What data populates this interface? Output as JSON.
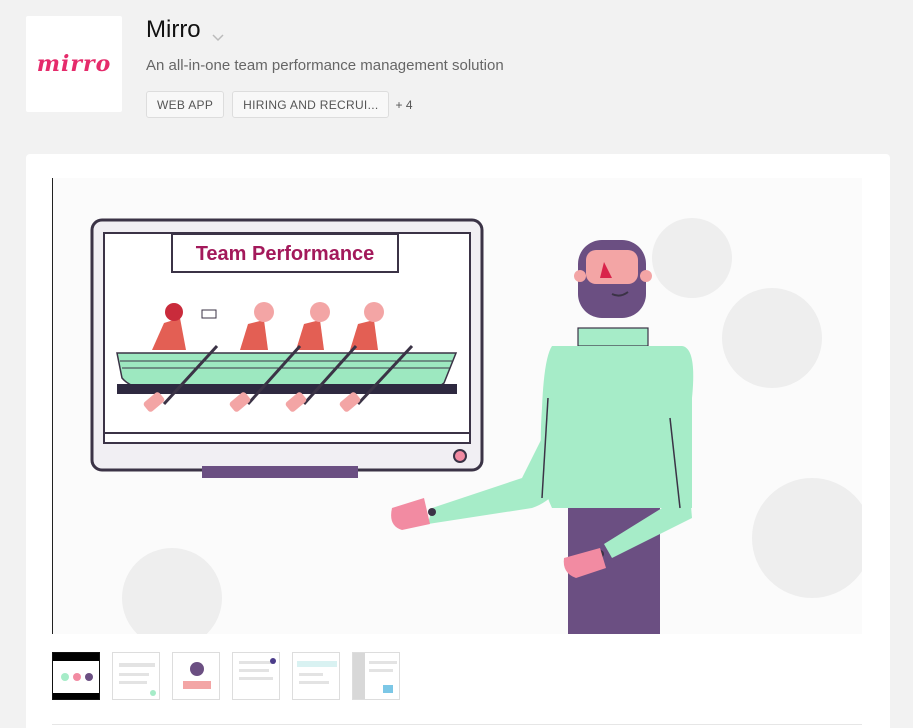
{
  "app": {
    "logo_text": "mirro",
    "name": "Mirro",
    "tagline": "An all-in-one team performance management solution",
    "tags": [
      "WEB APP",
      "HIRING AND RECRUI..."
    ],
    "more_tags": "+ 4"
  },
  "hero": {
    "board_title": "Team Performance",
    "icons": [
      "presenter-character",
      "rowing-boat",
      "monitor"
    ]
  },
  "gallery": {
    "thumbnail_count": 6,
    "active_index": 0
  },
  "colors": {
    "brand": "#e52b6b",
    "mint": "#a6ecc8",
    "purple": "#6b4f82",
    "crimson": "#a3195b"
  }
}
